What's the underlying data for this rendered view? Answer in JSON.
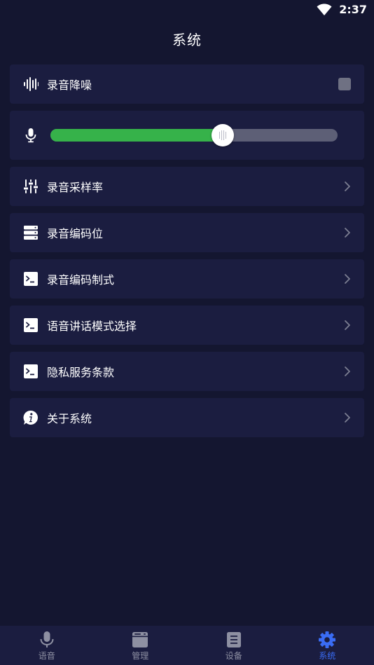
{
  "status_bar": {
    "time": "2:37"
  },
  "header": {
    "title": "系统"
  },
  "settings": {
    "noise_reduction": {
      "label": "录音降噪",
      "icon": "waveform-icon",
      "checked": false
    },
    "volume": {
      "icon": "microphone-icon",
      "level": 0.6
    },
    "items": [
      {
        "label": "录音采样率",
        "icon": "sliders-icon"
      },
      {
        "label": "录音编码位",
        "icon": "server-icon"
      },
      {
        "label": "录音编码制式",
        "icon": "terminal-icon"
      },
      {
        "label": "语音讲话模式选择",
        "icon": "terminal-icon"
      },
      {
        "label": "隐私服务条款",
        "icon": "terminal-icon"
      },
      {
        "label": "关于系统",
        "icon": "info-icon"
      }
    ]
  },
  "bottom_nav": {
    "items": [
      {
        "label": "语音",
        "icon": "microphone-icon",
        "active": false
      },
      {
        "label": "管理",
        "icon": "browser-window-icon",
        "active": false
      },
      {
        "label": "设备",
        "icon": "document-list-icon",
        "active": false
      },
      {
        "label": "系统",
        "icon": "gear-icon",
        "active": true
      }
    ]
  },
  "colors": {
    "background": "#141630",
    "card": "#1b1d40",
    "slider_fill": "#36b24a",
    "slider_track": "#5d5f76",
    "nav_active": "#3a6cf4",
    "nav_inactive": "#8e90a2"
  }
}
